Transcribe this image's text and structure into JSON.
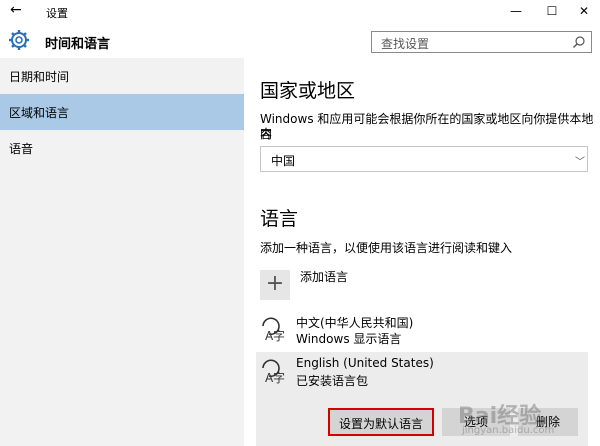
{
  "window": {
    "back_glyph": "←",
    "title": "设置",
    "minimize_glyph": "—",
    "maximize_glyph": "☐",
    "close_glyph": "✕"
  },
  "header": {
    "icon": "gear-icon",
    "title": "时间和语言",
    "search_placeholder": "查找设置",
    "search_icon": "search-icon"
  },
  "sidebar": {
    "items": [
      {
        "label": "日期和时间",
        "active": false
      },
      {
        "label": "区域和语言",
        "active": true
      },
      {
        "label": "语音",
        "active": false
      }
    ]
  },
  "region": {
    "heading": "国家或地区",
    "description_line1": "Windows 和应用可能会根据你所在的国家或地区向你提供本地内",
    "description_line2": "容",
    "selected": "中国"
  },
  "language": {
    "heading": "语言",
    "description": "添加一种语言，以便使用该语言进行阅读和键入",
    "add_label": "添加语言",
    "add_glyph": "+",
    "items": [
      {
        "name": "中文(中华人民共和国)",
        "detail": "Windows 显示语言",
        "icon": "language-icon"
      },
      {
        "name": "English (United States)",
        "detail": "已安装语言包",
        "icon": "language-icon"
      }
    ],
    "buttons": {
      "set_default": "设置为默认语言",
      "options": "选项",
      "remove": "删除"
    }
  },
  "watermark": {
    "text": "Bai经验",
    "sub": "jingyan.baidu.com"
  },
  "colors": {
    "sidebar_bg": "#f2f2f2",
    "active_item_bg": "#a9c9e6",
    "highlight_border": "#d30000",
    "button_bg": "#d4d4d4"
  }
}
